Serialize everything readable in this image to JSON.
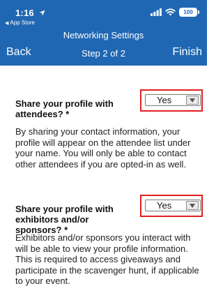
{
  "status_bar": {
    "time": "1:16",
    "back_app": "App Store",
    "battery": "100"
  },
  "header": {
    "title": "Networking Settings",
    "back_label": "Back",
    "step_label": "Step 2 of 2",
    "finish_label": "Finish"
  },
  "settings": [
    {
      "question": "Share your profile with attendees? *",
      "value": "Yes",
      "description": "By sharing your contact information, your profile will appear on the attendee list under your name. You will only be able to contact other attendees if you are opted-in as well."
    },
    {
      "question": "Share your profile with exhibitors and/or sponsors? *",
      "value": "Yes",
      "description": "Exhibitors and/or sponsors you interact with will be able to view your profile information. This is required to access giveaways and participate in the scavenger hunt, if applicable to your event."
    }
  ],
  "colors": {
    "header_bg": "#1f67b3",
    "highlight_border": "#e02020"
  }
}
